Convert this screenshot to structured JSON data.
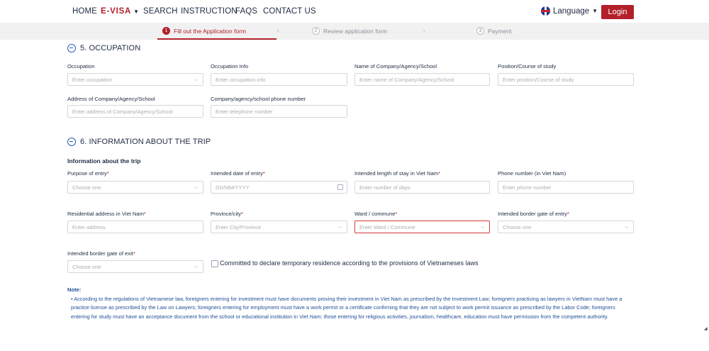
{
  "nav": {
    "home": "HOME",
    "evisa": "E-VISA",
    "search": "SEARCH",
    "instruction": "INSTRUCTION",
    "faqs": "FAQS",
    "contact": "CONTACT US",
    "language": "Language",
    "login": "Login",
    "caret_icon": "caret-down-icon"
  },
  "steps": [
    {
      "num": "1",
      "label": "Fill out the Application form",
      "active": true
    },
    {
      "num": "2",
      "label": "Review application form",
      "active": false
    },
    {
      "num": "3",
      "label": "Payment",
      "active": false
    }
  ],
  "occupation": {
    "title": "5. OCCUPATION",
    "fields": [
      {
        "label": "Occupation",
        "placeholder": "Enter occupation",
        "type": "select"
      },
      {
        "label": "Occupation Info",
        "placeholder": "Enter occupation info",
        "type": "text"
      },
      {
        "label": "Name of Company/Agency/School",
        "placeholder": "Enter name of Company/Agency/School",
        "type": "text"
      },
      {
        "label": "Position/Course of study",
        "placeholder": "Enter position/Course of study",
        "type": "text"
      },
      {
        "label": "Address of Company/Agency/School",
        "placeholder": "Enter address of Company/Agency/School",
        "type": "text"
      },
      {
        "label": "Company/agency/school phone number",
        "placeholder": "Enter telephone number",
        "type": "text"
      }
    ]
  },
  "trip": {
    "title": "6. INFORMATION ABOUT THE TRIP",
    "subtitle": "Information about the trip",
    "fields": [
      {
        "label": "Purpose of entry",
        "required": "*",
        "placeholder": "Choose one",
        "type": "select"
      },
      {
        "label": "Intended date of entry",
        "required": "*",
        "placeholder": "DD/MM/YYYY",
        "type": "date"
      },
      {
        "label": "Intended length of stay in Viet Nam",
        "required": "*",
        "placeholder": "Enter number of days",
        "type": "text"
      },
      {
        "label": "Phone number (in Viet Nam)",
        "required": "",
        "placeholder": "Enter phone number",
        "type": "text"
      },
      {
        "label": "Residential address in Viet Nam",
        "required": "*",
        "placeholder": "Enter address",
        "type": "text"
      },
      {
        "label": "Province/city",
        "required": "*",
        "placeholder": "Enter City/Province",
        "type": "select"
      },
      {
        "label": "Ward / commune",
        "required": "*",
        "placeholder": "Enter Ward / Commune",
        "type": "select",
        "error": true
      },
      {
        "label": "Intended border gate of entry",
        "required": "*",
        "placeholder": "Choose one",
        "type": "select"
      },
      {
        "label": "Intended border gate of exit",
        "required": "*",
        "placeholder": "Choose one",
        "type": "select"
      }
    ],
    "commit_label": "Committed to declare temporary residence according to the provisions of Vietnameses laws",
    "commit_checked": false
  },
  "note": {
    "title": "Note:",
    "text": "• According to the regulations of Vietnamese law, foreigners entering for investment must have documents proving their investment in Viet Nam as prescribed by the Investment Law; foreigners practicing as lawyers in VietNam must have a practice license as prescribed by the Law on Lawyers; foreigners entering for employment must have a work permit or a certificate confirming that they are not subject to work permit issuance as prescribed by the Labor Code; foreigners entering for study must have an acceptance document from the school or educational institution in Viet Nam; those entering for religious activities, journalism, healthcare, education must have permission from the competent authority."
  }
}
